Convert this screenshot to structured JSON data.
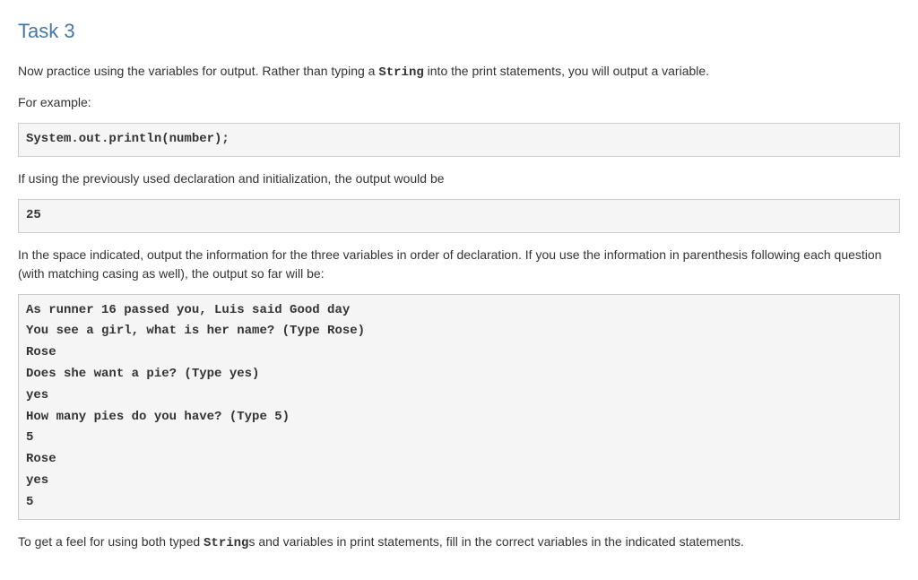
{
  "heading": "Task 3",
  "intro": {
    "p1_a": "Now practice using the variables for output. Rather than typing a ",
    "p1_code": "String",
    "p1_b": " into the print statements, you will output a variable.",
    "p2": "For example:"
  },
  "code1": "System.out.println(number);",
  "p3": "If using the previously used declaration and initialization, the output would be",
  "code2": "25",
  "p4": "In the space indicated, output the information for the three variables in order of declaration. If you use the information in parenthesis following each question (with matching casing as well), the output so far will be:",
  "code3": "As runner 16 passed you, Luis said Good day\nYou see a girl, what is her name? (Type Rose)\nRose\nDoes she want a pie? (Type yes)\nyes\nHow many pies do you have? (Type 5)\n5\nRose\nyes\n5",
  "outro": {
    "a": "To get a feel for using both typed ",
    "code": "String",
    "b": "s and variables in print statements, fill in the correct variables in the indicated statements."
  }
}
